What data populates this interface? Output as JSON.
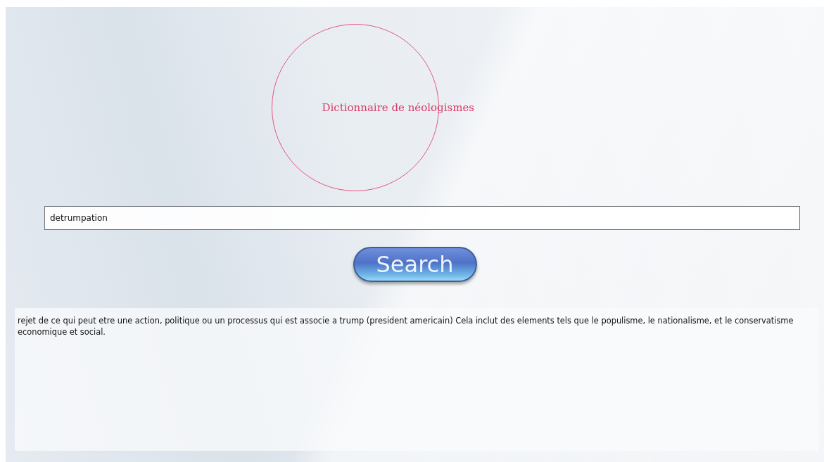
{
  "logo": {
    "title": "Dictionnaire de néologismes"
  },
  "search": {
    "value": "detrumpation"
  },
  "button": {
    "label": "Search"
  },
  "result": {
    "text": " rejet de ce qui peut etre une action, politique ou un processus qui est associe a trump (president americain) Cela inclut des elements tels que le populisme, le nationalisme, et le conservatisme economique et social."
  }
}
